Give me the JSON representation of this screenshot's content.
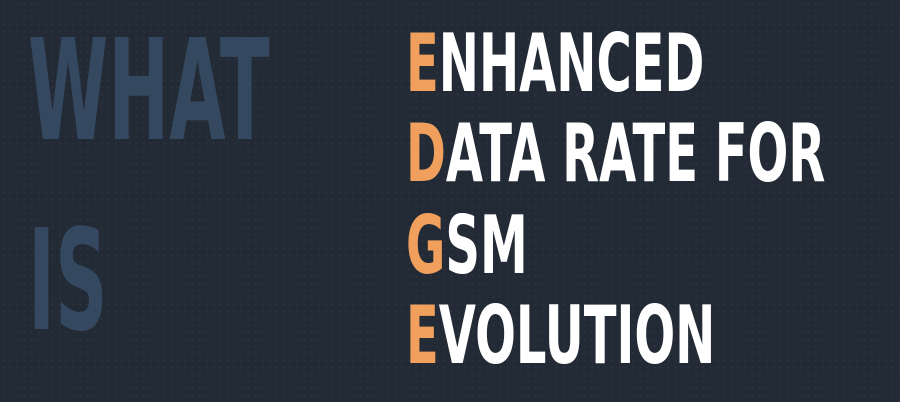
{
  "heading": {
    "word_1": "WHAT",
    "word_2": "IS"
  },
  "acronym": {
    "lines": [
      {
        "initial": "E",
        "rest": "NHANCED"
      },
      {
        "initial": "D",
        "rest": "ATA RATE FOR"
      },
      {
        "initial": "G",
        "rest": "SM"
      },
      {
        "initial": "E",
        "rest": "VOLUTION"
      }
    ]
  },
  "colors": {
    "background": "#222a36",
    "heading": "#34485f",
    "text": "#ffffff",
    "accent": "#f0a05c"
  }
}
